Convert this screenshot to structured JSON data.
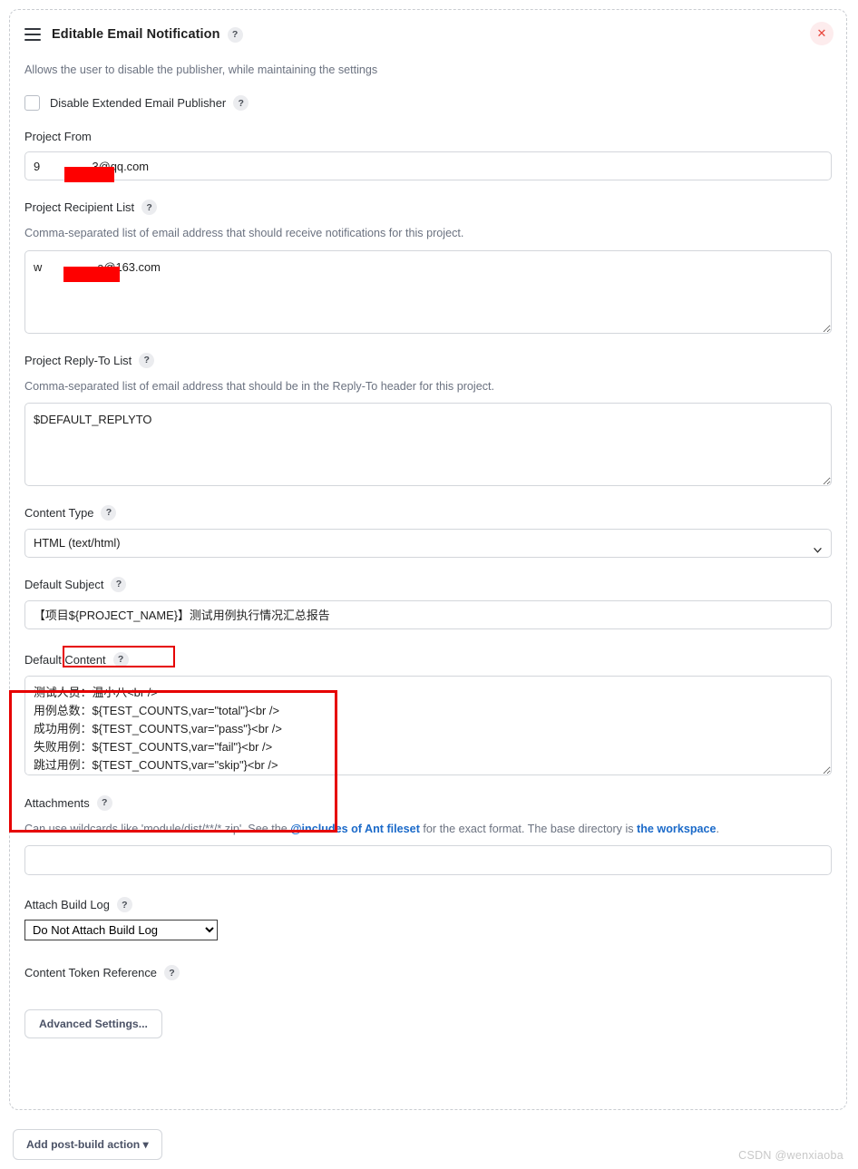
{
  "header": {
    "title": "Editable Email Notification",
    "help_glyph": "?",
    "close_glyph": "✕",
    "description": "Allows the user to disable the publisher, while maintaining the settings"
  },
  "disable_publisher": {
    "label": "Disable Extended Email Publisher",
    "help_glyph": "?",
    "checked": false
  },
  "fields": {
    "project_from": {
      "label": "Project From",
      "value": "9                3@qq.com",
      "value_plain": "9█████3@qq.com"
    },
    "project_recipient_list": {
      "label": "Project Recipient List",
      "help_glyph": "?",
      "description": "Comma-separated list of email address that should receive notifications for this project.",
      "value": "w                 a@163.com",
      "value_plain": "w██████a@163.com"
    },
    "project_reply_to_list": {
      "label": "Project Reply-To List",
      "help_glyph": "?",
      "description": "Comma-separated list of email address that should be in the Reply-To header for this project.",
      "value": "$DEFAULT_REPLYTO"
    },
    "content_type": {
      "label": "Content Type",
      "help_glyph": "?",
      "selected": "HTML (text/html)",
      "options": [
        "HTML (text/html)"
      ]
    },
    "default_subject": {
      "label": "Default Subject",
      "help_glyph": "?",
      "value": "【项目${PROJECT_NAME}】测试用例执行情况汇总报告",
      "highlighted_token": "${PROJECT_NAME}"
    },
    "default_content": {
      "label": "Default Content",
      "help_glyph": "?",
      "value": "测试人员：温小八<br />\n用例总数：${TEST_COUNTS,var=\"total\"}<br />\n成功用例：${TEST_COUNTS,var=\"pass\"}<br />\n失败用例：${TEST_COUNTS,var=\"fail\"}<br />\n跳过用例：${TEST_COUNTS,var=\"skip\"}<br />\n测试报告详情地址：${PROJECT_URL}allure<br />"
    },
    "attachments": {
      "label": "Attachments",
      "help_glyph": "?",
      "desc_part1": "Can use wildcards like 'module/dist/**/*.zip'. See the ",
      "desc_link1": "@includes of Ant fileset",
      "desc_part2": " for the exact format. The base directory is ",
      "desc_link2": "the workspace",
      "desc_part3": ".",
      "value": ""
    },
    "attach_build_log": {
      "label": "Attach Build Log",
      "help_glyph": "?",
      "selected": "Do Not Attach Build Log",
      "options": [
        "Do Not Attach Build Log"
      ]
    },
    "content_token_reference": {
      "label": "Content Token Reference",
      "help_glyph": "?"
    }
  },
  "buttons": {
    "advanced_settings": "Advanced Settings...",
    "add_post_build_action": "Add post-build action ▾"
  },
  "watermark": "CSDN @wenxiaoba",
  "colors": {
    "annotation_red": "#e60000",
    "redaction_red": "#fe0000",
    "link_blue": "#1b6ac9",
    "close_red": "#e8443a"
  }
}
